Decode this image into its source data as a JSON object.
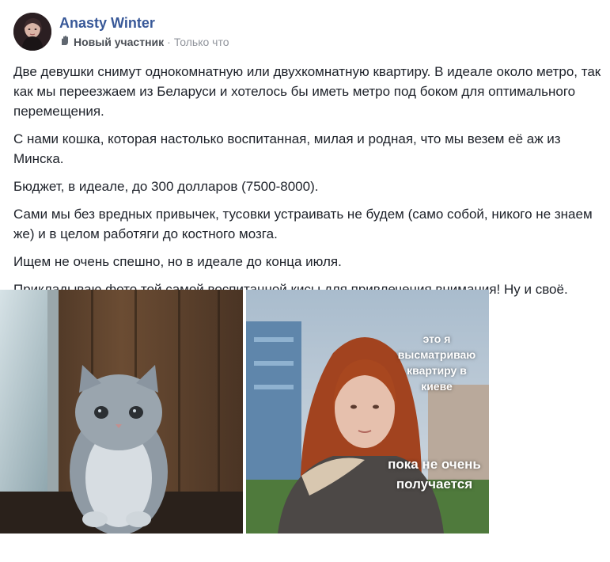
{
  "post": {
    "author": "Anasty Winter",
    "badge": "Новый участник",
    "time": "Только что",
    "paragraphs": [
      "Две девушки снимут однокомнатную или двухкомнатную квартиру. В идеале около метро, так как мы переезжаем из Беларуси и хотелось бы иметь метро под боком для оптимального перемещения.",
      "С нами кошка, которая настолько воспитанная, милая и родная, что мы везем её аж из Минска.",
      "Бюджет, в идеале, до 300 долларов (7500-8000).",
      "Сами мы без вредных привычек, тусовки устраивать не будем (само собой, никого не знаем же) и в целом работяги до костного мозга.",
      "Ищем не очень спешно, но в идеале до конца июля.",
      "Прикладываю фото той самой воспитанной кисы для привлечения внимания! Ну и своё."
    ]
  },
  "photos": {
    "cat": {
      "icon": "cat-photo"
    },
    "girl": {
      "icon": "girl-photo",
      "caption_top": "это я высматриваю квартиру в киеве",
      "caption_bottom": "пока не очень получается"
    }
  },
  "colors": {
    "link": "#385898",
    "meta": "#606770"
  }
}
